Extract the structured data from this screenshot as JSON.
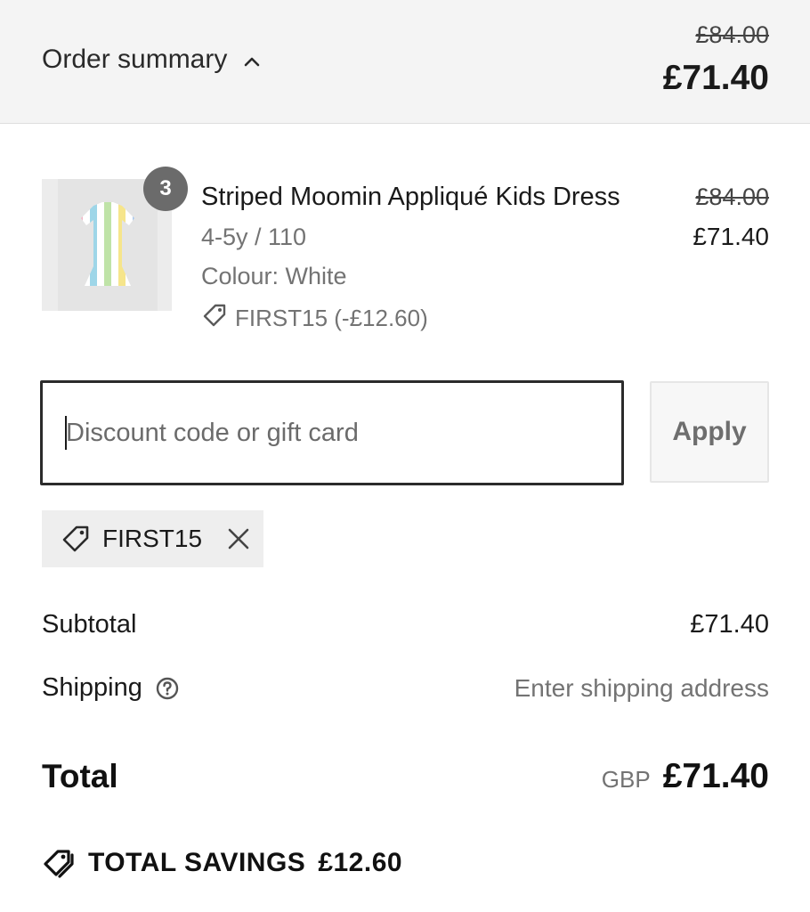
{
  "header": {
    "toggle_label": "Order summary",
    "original_total": "£84.00",
    "current_total": "£71.40"
  },
  "product": {
    "quantity": "3",
    "name": "Striped Moomin Appliqué Kids Dress",
    "size": "4-5y / 110",
    "colour": "Colour: White",
    "discount": "FIRST15 (-£12.60)",
    "original_price": "£84.00",
    "price": "£71.40",
    "image_icon": "dress-thumbnail"
  },
  "discount_form": {
    "placeholder": "Discount code or gift card",
    "value": "",
    "apply_label": "Apply"
  },
  "applied_code": {
    "code": "FIRST15",
    "icon": "tag-icon",
    "remove_icon": "close-icon"
  },
  "totals": {
    "subtotal_label": "Subtotal",
    "subtotal_value": "£71.40",
    "shipping_label": "Shipping",
    "shipping_value": "Enter shipping address",
    "total_label": "Total",
    "currency": "GBP",
    "total_value": "£71.40"
  },
  "savings": {
    "label": "TOTAL SAVINGS",
    "value": "£12.60"
  },
  "colors": {
    "header_bg": "#f4f4f4",
    "badge_bg": "#6b6b6b",
    "chip_bg": "#eeeeee",
    "muted_text": "#737373"
  }
}
